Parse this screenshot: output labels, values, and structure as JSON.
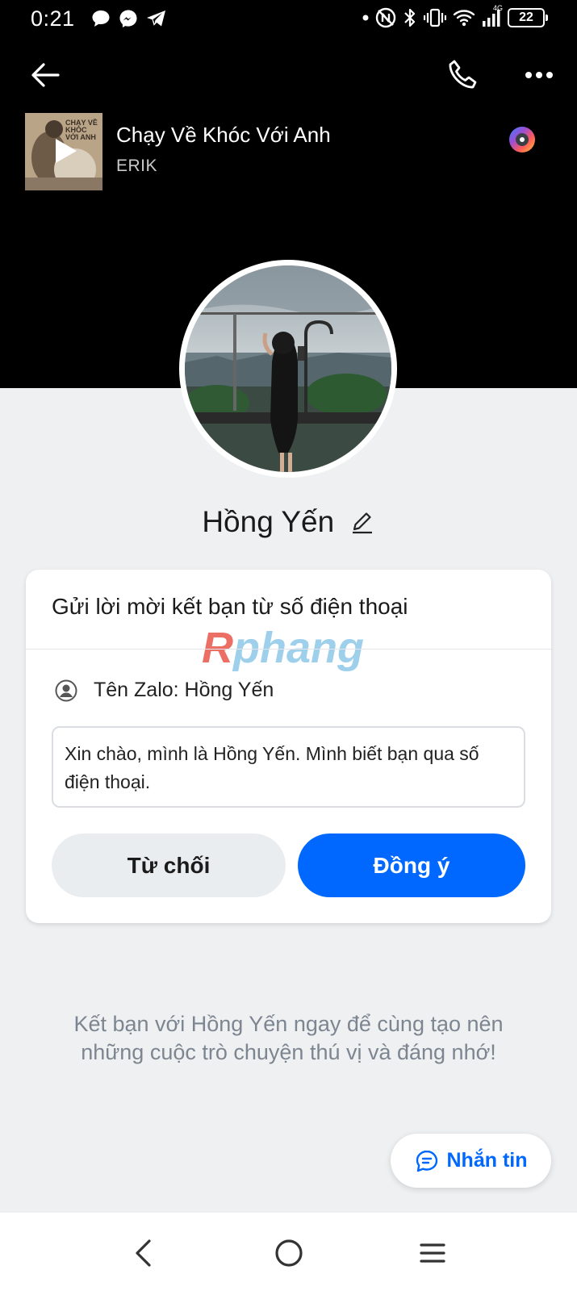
{
  "status_bar": {
    "time": "0:21",
    "battery": "22",
    "network": "4G",
    "left_icons": [
      "chat-bubble-icon",
      "messenger-icon",
      "telegram-icon"
    ],
    "right_icons": [
      "dot-icon",
      "nfc-icon",
      "bluetooth-icon",
      "vibrate-icon",
      "wifi-icon",
      "signal-icon",
      "battery-icon"
    ]
  },
  "topbar": {
    "icons": [
      "back-arrow-icon",
      "phone-icon",
      "more-icon"
    ]
  },
  "music": {
    "song_title": "Chạy Về Khóc Với Anh",
    "artist": "ERIK",
    "album_text": "CHẠY VỀ KHÓC VỚI ANH",
    "icons": [
      "play-icon",
      "music-disc-icon"
    ]
  },
  "profile": {
    "name": "Hồng Yến",
    "edit_icon": "pencil-icon"
  },
  "friend_request": {
    "title": "Gửi lời mời kết bạn từ số điện thoại",
    "watermark": "Rphang",
    "zalo_name_label": "Tên Zalo: Hồng Yến",
    "message": "Xin chào, mình là Hồng Yến. Mình biết bạn qua số điện thoại.",
    "decline_label": "Từ chối",
    "accept_label": "Đồng ý"
  },
  "invite_text": "Kết bạn với Hồng Yến ngay để cùng tạo nên những cuộc trò chuyện thú vị và đáng nhớ!",
  "fab": {
    "label": "Nhắn tin",
    "icon": "chat-icon"
  },
  "nav": {
    "icons": [
      "nav-back-icon",
      "nav-home-icon",
      "nav-menu-icon"
    ]
  },
  "colors": {
    "header_bg": "#000000",
    "page_bg": "#eef0f2",
    "accent": "#0068ff",
    "decline_bg": "#eaedf0",
    "muted_text": "#7d8690"
  }
}
